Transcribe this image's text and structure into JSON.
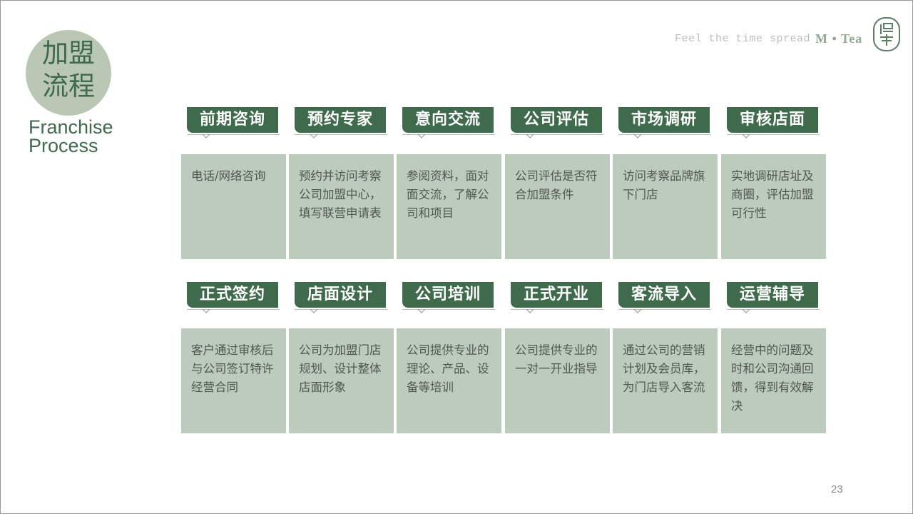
{
  "slide": {
    "title_cn": "加盟\n流程",
    "title_cn_line1": "加盟",
    "title_cn_line2": "流程",
    "title_en_line1": "Franchise",
    "title_en_line2": "Process",
    "tagline": "Feel the time spread",
    "brand": "M • Tea",
    "page_number": "23"
  },
  "colors": {
    "accent": "#3f6a4c",
    "box": "#bccbbb",
    "circle": "#b9c7b4"
  },
  "steps": [
    {
      "title": "前期咨询",
      "desc": "电话/网络咨询"
    },
    {
      "title": "预约专家",
      "desc": "预约并访问考察公司加盟中心，填写联营申请表"
    },
    {
      "title": "意向交流",
      "desc": "参阅资料，面对面交流，了解公司和项目"
    },
    {
      "title": "公司评估",
      "desc": "公司评估是否符合加盟条件"
    },
    {
      "title": "市场调研",
      "desc": "访问考察品牌旗下门店"
    },
    {
      "title": "审核店面",
      "desc": "实地调研店址及商圈，评估加盟可行性"
    },
    {
      "title": "正式签约",
      "desc": "客户通过审核后与公司签订特许经营合同"
    },
    {
      "title": "店面设计",
      "desc": "公司为加盟门店规划、设计整体店面形象"
    },
    {
      "title": "公司培训",
      "desc": "公司提供专业的理论、产品、设备等培训"
    },
    {
      "title": "正式开业",
      "desc": "公司提供专业的一对一开业指导"
    },
    {
      "title": "客流导入",
      "desc": "通过公司的营销计划及会员库，为门店导入客流"
    },
    {
      "title": "运营辅导",
      "desc": "经营中的问题及时和公司沟通回馈，得到有效解决"
    }
  ]
}
